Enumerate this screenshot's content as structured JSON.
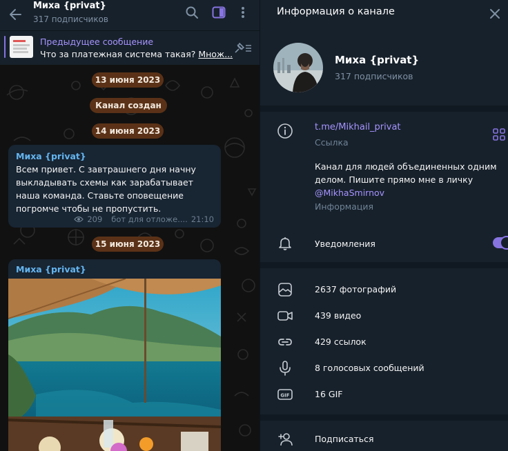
{
  "chat": {
    "title": "Миха {privat}",
    "subscribers": "317 подписчиков",
    "pinned": {
      "title": "Предыдущее сообщение",
      "text": "Что за платежная система такая?",
      "more": "Множ..."
    },
    "dates": [
      "13 июня 2023",
      "Канал создан",
      "14 июня 2023",
      "15 июня 2023"
    ],
    "messages": [
      {
        "author": "Миха {privat}",
        "text": "Всем привет. С завтрашнего дня начну выкладывать схемы как зарабатывает наша команда. Ставьте оповещение погромче чтобы не пропустить.",
        "views": "209",
        "signature": "бот для отложе....",
        "time": "21:10"
      },
      {
        "author": "Миха {privat}"
      }
    ]
  },
  "info": {
    "title": "Информация о канале",
    "name": "Миха {privat}",
    "subscribers": "317 подписчиков",
    "link": "t.me/Mikhail_privat",
    "link_caption": "Ссылка",
    "about_text": "Канал для людей объединенных одним делом. Пишите прямо мне в личку",
    "about_mention": "@MikhaSmirnov",
    "about_caption": "Информация",
    "notifications_label": "Уведомления",
    "notifications_on": true,
    "media": [
      {
        "icon": "photo-icon",
        "label": "2637 фотографий"
      },
      {
        "icon": "video-icon",
        "label": "439 видео"
      },
      {
        "icon": "link-icon",
        "label": "429 ссылок"
      },
      {
        "icon": "microphone-icon",
        "label": "8 голосовых сообщений"
      },
      {
        "icon": "gif-icon",
        "label": "16 GIF"
      }
    ],
    "subscribe_label": "Подписаться"
  },
  "colors": {
    "accent": "#8774e1",
    "link": "#a694ff",
    "author": "#64b5ef",
    "date_pill": "#5b3217"
  }
}
